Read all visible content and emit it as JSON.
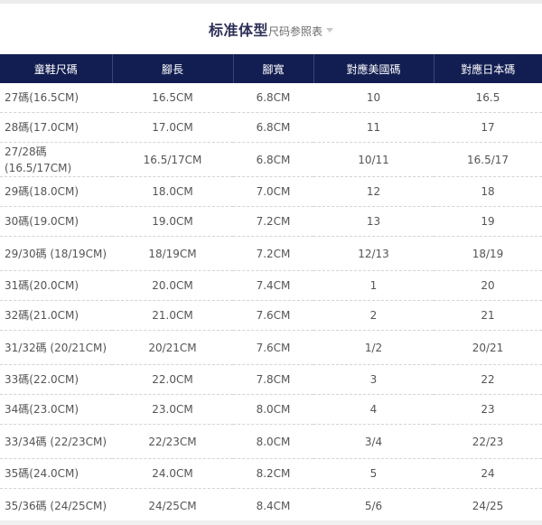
{
  "title": {
    "main": "标准体型",
    "sub": "尺码参照表"
  },
  "table": {
    "headers": [
      "童鞋尺碼",
      "腳長",
      "腳寬",
      "對應美國碼",
      "對應日本碼"
    ],
    "rows": [
      [
        "27碼(16.5CM)",
        "16.5CM",
        "6.8CM",
        "10",
        "16.5"
      ],
      [
        "28碼(17.0CM)",
        "17.0CM",
        "6.8CM",
        "11",
        "17"
      ],
      [
        "27/28碼 (16.5/17CM)",
        "16.5/17CM",
        "6.8CM",
        "10/11",
        "16.5/17"
      ],
      [
        "29碼(18.0CM)",
        "18.0CM",
        "7.0CM",
        "12",
        "18"
      ],
      [
        "30碼(19.0CM)",
        "19.0CM",
        "7.2CM",
        "13",
        "19"
      ],
      [
        "29/30碼 (18/19CM)",
        "18/19CM",
        "7.2CM",
        "12/13",
        "18/19"
      ],
      [
        "31碼(20.0CM)",
        "20.0CM",
        "7.4CM",
        "1",
        "20"
      ],
      [
        "32碼(21.0CM)",
        "21.0CM",
        "7.6CM",
        "2",
        "21"
      ],
      [
        "31/32碼 (20/21CM)",
        "20/21CM",
        "7.6CM",
        "1/2",
        "20/21"
      ],
      [
        "33碼(22.0CM)",
        "22.0CM",
        "7.8CM",
        "3",
        "22"
      ],
      [
        "34碼(23.0CM)",
        "23.0CM",
        "8.0CM",
        "4",
        "23"
      ],
      [
        "33/34碼 (22/23CM)",
        "22/23CM",
        "8.0CM",
        "3/4",
        "22/23"
      ],
      [
        "35碼(24.0CM)",
        "24.0CM",
        "8.2CM",
        "5",
        "24"
      ],
      [
        "35/36碼 (24/25CM)",
        "24/25CM",
        "8.4CM",
        "5/6",
        "24/25"
      ]
    ]
  }
}
